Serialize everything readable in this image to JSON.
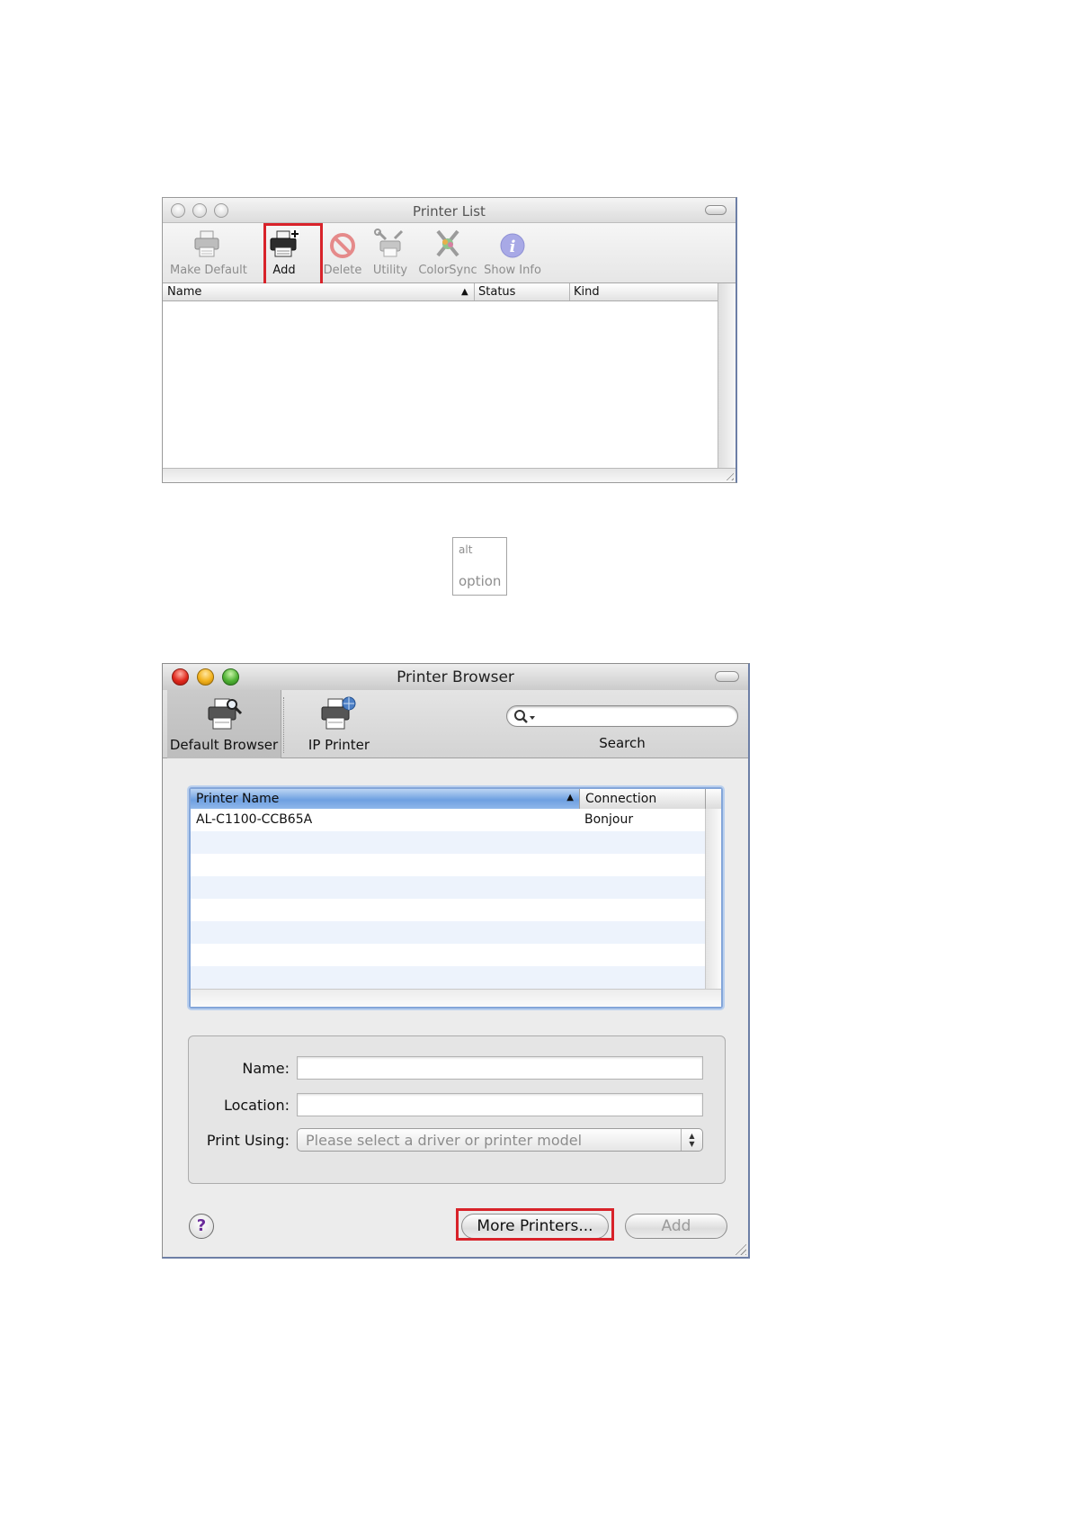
{
  "printer_list": {
    "title": "Printer List",
    "toolbar": [
      {
        "label": "Make Default",
        "icon": "printer-icon"
      },
      {
        "label": "Add",
        "icon": "add-printer-icon",
        "highlighted": true
      },
      {
        "label": "Delete",
        "icon": "delete-icon"
      },
      {
        "label": "Utility",
        "icon": "utility-icon"
      },
      {
        "label": "ColorSync",
        "icon": "colorsync-icon"
      },
      {
        "label": "Show Info",
        "icon": "info-icon"
      }
    ],
    "columns": [
      "Name",
      "Status",
      "Kind"
    ],
    "rows": []
  },
  "key": {
    "top": "alt",
    "bottom": "option"
  },
  "printer_browser": {
    "title": "Printer Browser",
    "toolbar": [
      {
        "label": "Default Browser",
        "icon": "default-browser-icon",
        "selected": true
      },
      {
        "label": "IP Printer",
        "icon": "ip-printer-icon"
      }
    ],
    "search_label": "Search",
    "search_value": "",
    "columns": [
      "Printer Name",
      "Connection"
    ],
    "rows": [
      {
        "name": "AL-C1100-CCB65A",
        "connection": "Bonjour"
      }
    ],
    "form": {
      "name_label": "Name:",
      "name_value": "",
      "location_label": "Location:",
      "location_value": "",
      "print_using_label": "Print Using:",
      "print_using_value": "Please select a driver or printer model"
    },
    "buttons": {
      "help": "?",
      "more_printers": "More Printers...",
      "add": "Add"
    }
  },
  "colors": {
    "highlight": "#d8232a",
    "selection_header": "#6ea0e1"
  }
}
